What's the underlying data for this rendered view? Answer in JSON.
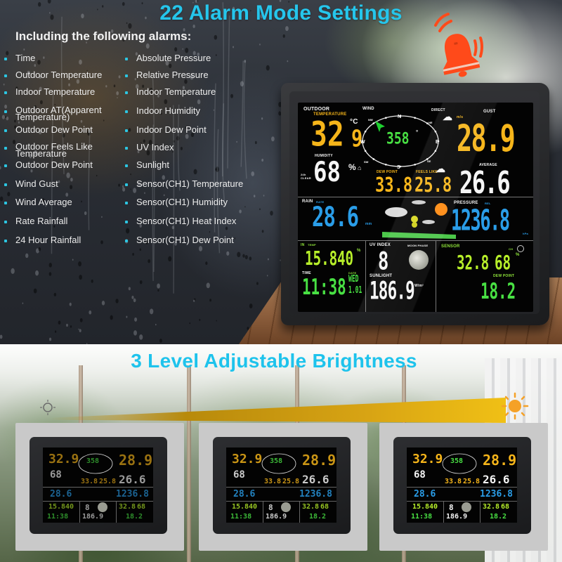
{
  "alarm_section": {
    "title": "22 Alarm Mode Settings",
    "subtitle": "Including the following alarms:",
    "left_items": [
      "Time",
      "Outdoor Temperature",
      "Indoor Temperature",
      "Outdoor AT(Apparent\nTemperature)",
      "Outdoor Dew Point",
      "Outdoor Feels Like\nTemperature",
      "Outdoor Dew Point",
      "Wind Gust",
      "Wind Average",
      "Rate Rainfall",
      "24 Hour Rainfall"
    ],
    "right_items": [
      "Absolute Pressure",
      "Relative Pressure",
      "Indoor Temperature",
      "Indoor Humidity",
      "Indoor Dew Point",
      "UV Index",
      "Sunlight",
      "Sensor(CH1) Temperature",
      "Sensor(CH1) Humidity",
      "Sensor(CH1) Heat Index",
      "Sensor(CH1)  Dew Point"
    ],
    "icon": "ringing-bell-icon",
    "accent_color": "#25c6ec",
    "bell_color": "#ff4a1a"
  },
  "display": {
    "outdoor_label": "OUTDOOR",
    "temperature_label": "TEMPERATURE",
    "outdoor_temp_int": "32",
    "outdoor_temp_dec": "9",
    "temp_unit": "°C",
    "humidity_label": "HUMIDITY",
    "humidity_value": "68",
    "humidity_unit": "%",
    "clear_label": "24h CLEAR",
    "wind_label": "WIND",
    "direct_label": "DIRECT",
    "compass": {
      "n": "N",
      "e": "E",
      "s": "S",
      "w": "W",
      "nw": "NW",
      "ne": "NE",
      "sw": "SW",
      "se": "SE"
    },
    "wind_direction_deg": "358",
    "degree_symbol": "°",
    "dew_point_label": "DEW POINT",
    "dew_point_value": "33.8",
    "feels_like_label": "FEELS LIKE",
    "feels_like_value": "25.8",
    "wind_unit": "m/s",
    "gust_label": "GUST",
    "gust_value": "28.9",
    "average_label": "AVERAGE",
    "average_value": "26.6",
    "rain_label": "RAIN",
    "rate_label": "RATE",
    "rain_value": "28.6",
    "rain_unit": "mm",
    "pressure_label": "PRESSURE",
    "rel_label": "REL",
    "pressure_value": "1236.8",
    "pressure_unit": "hPa",
    "in_label": "IN",
    "in_temp_label": "TEMP",
    "indoor_temp": "15.8",
    "indoor_humidity": "40",
    "time_label": "TIME",
    "time_value": "11:38",
    "date_label": "DATE",
    "date_day": "WED",
    "date_value": "1.01",
    "uv_label": "UV INDEX",
    "uv_value": "8",
    "moon_label": "MOON PHASE",
    "sunlight_label": "SUNLIGHT",
    "sunlight_value": "186.9",
    "sunlight_unit": "W/m²",
    "sensor_label": "SENSOR",
    "channel_label": "CH",
    "sensor_temp": "32.8",
    "sensor_humidity": "68",
    "sensor_dew_label": "DEW POINT",
    "sensor_dew_value": "18.2",
    "colors": {
      "yellow": "#f6b51a",
      "white": "#f5f5f5",
      "blue": "#2a9de8",
      "green": "#48e043",
      "lime": "#b7ef2a"
    }
  },
  "brightness_section": {
    "title": "3 Level Adjustable Brightness",
    "levels": [
      "low",
      "medium",
      "high"
    ],
    "dim_icon": "sun-outline-icon",
    "bright_icon": "sun-icon"
  }
}
